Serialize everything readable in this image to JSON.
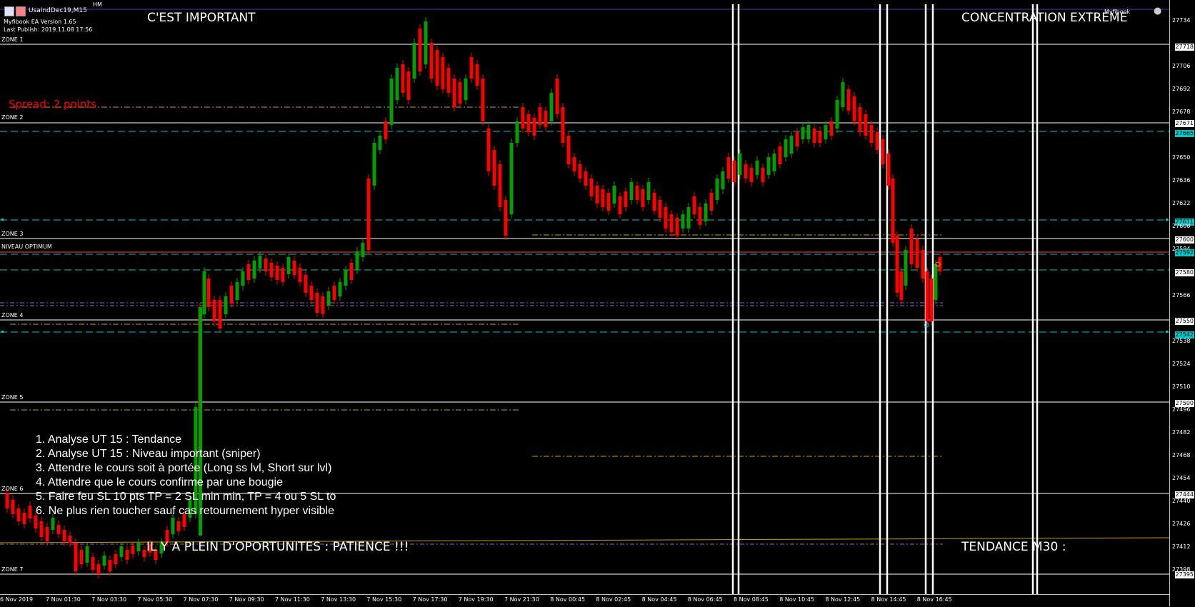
{
  "window": {
    "title": "UsaIndDec19,M15",
    "ea_name": "Myfibook EA Version 1.65",
    "last_publish": "Last Publish: 2019.11.08 17:56",
    "hm_label": "HM",
    "brand": "Myfibook"
  },
  "annotations": {
    "top_left": "C'EST IMPORTANT",
    "top_right": "CONCENTRATION EXTREME",
    "bottom_center": "IL Y A PLEIN D'OPORTUNITES : PATIENCE !!!",
    "bottom_right": "TENDANCE M30 :",
    "spread": "Spread: 2 points",
    "niveau": "NIVEAU OPTIMUM"
  },
  "zones": [
    "ZONE 1",
    "ZONE 2",
    "ZONE 3",
    "ZONE 4",
    "ZONE 5",
    "ZONE 6",
    "ZONE 7"
  ],
  "checklist": [
    "1. Analyse UT 15 : Tendance",
    "2. Analyse UT 15 : Niveau important (sniper)",
    "3. Attendre le cours soit à portée (Long ss lvl, Short sur lvl)",
    "4. Attendre que le cours confirme par une bougie",
    "5. Faire feu SL 10 pts TP = 2 SL min min, TP = 4 ou 5 SL to",
    "6. Ne plus rien toucher sauf cas retournement hyper visible"
  ],
  "price_axis": [
    "27734",
    "27718",
    "27706",
    "27692",
    "27678",
    "27671",
    "27665",
    "27650",
    "27636",
    "27622",
    "27611",
    "27608",
    "27600",
    "27594",
    "27592",
    "27580",
    "27566",
    "27550",
    "27542",
    "27538",
    "27524",
    "27510",
    "27500",
    "27496",
    "27482",
    "27468",
    "27454",
    "27444",
    "27440",
    "27426",
    "27412",
    "27398",
    "27395"
  ],
  "highlighted_prices": [
    "27718",
    "27671",
    "27665",
    "27611",
    "27600",
    "27592",
    "27580",
    "27550",
    "27542",
    "27500",
    "27444",
    "27395"
  ],
  "time_axis": [
    "6 Nov 2019",
    "7 Nov 01:30",
    "7 Nov 03:30",
    "7 Nov 05:30",
    "7 Nov 07:30",
    "7 Nov 09:30",
    "7 Nov 11:30",
    "7 Nov 13:30",
    "7 Nov 15:30",
    "7 Nov 17:30",
    "7 Nov 19:30",
    "7 Nov 21:30",
    "8 Nov 00:45",
    "8 Nov 02:45",
    "8 Nov 04:45",
    "8 Nov 06:45",
    "8 Nov 08:45",
    "8 Nov 10:45",
    "8 Nov 12:45",
    "8 Nov 14:45",
    "8 Nov 16:45"
  ],
  "colors": {
    "bull": "#00a000",
    "bear": "#ff0000",
    "cyan_line": "#00c8c8",
    "gold_line": "#c8a000",
    "purple_line": "#9966cc",
    "zone_line": "#ffffff",
    "red_line": "#ff4040"
  }
}
